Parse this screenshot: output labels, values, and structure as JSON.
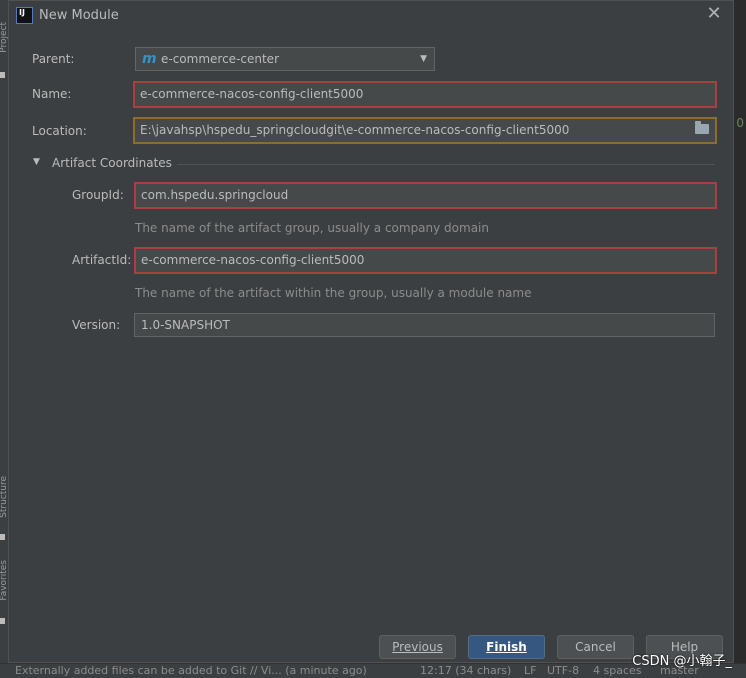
{
  "dialog": {
    "title": "New Module",
    "app_icon": "IJ",
    "close_icon": "✕"
  },
  "form": {
    "parent_label": "Parent:",
    "parent_value": "e-commerce-center",
    "parent_icon": "m",
    "name_label": "Name:",
    "name_value": "e-commerce-nacos-config-client5000",
    "location_label": "Location:",
    "location_value": "E:\\javahsp\\hspedu_springcloudgit\\e-commerce-nacos-config-client5000",
    "section_title": "Artifact Coordinates",
    "groupid_label": "GroupId:",
    "groupid_value": "com.hspedu.springcloud",
    "groupid_hint": "The name of the artifact group, usually a company domain",
    "artifactid_label": "ArtifactId:",
    "artifactid_value": "e-commerce-nacos-config-client5000",
    "artifactid_hint": "The name of the artifact within the group, usually a module name",
    "version_label": "Version:",
    "version_value": "1.0-SNAPSHOT"
  },
  "buttons": {
    "previous": "Previous",
    "finish": "Finish",
    "cancel": "Cancel",
    "help": "Help"
  },
  "side": {
    "project_tab": "Project",
    "structure_tab": "Structure",
    "favorites_tab": "Favorites"
  },
  "statusbar": {
    "message": "Externally added files can be added to Git // Vi... (a minute ago)",
    "position": "12:17 (34 chars)",
    "line_sep": "LF",
    "encoding": "UTF-8",
    "indent": "4 spaces",
    "branch": "master"
  },
  "watermark": "CSDN @小翰子_",
  "colors": {
    "error_border": "#a5423f",
    "warning_border": "#8d6c2f",
    "primary_button": "#365880"
  }
}
